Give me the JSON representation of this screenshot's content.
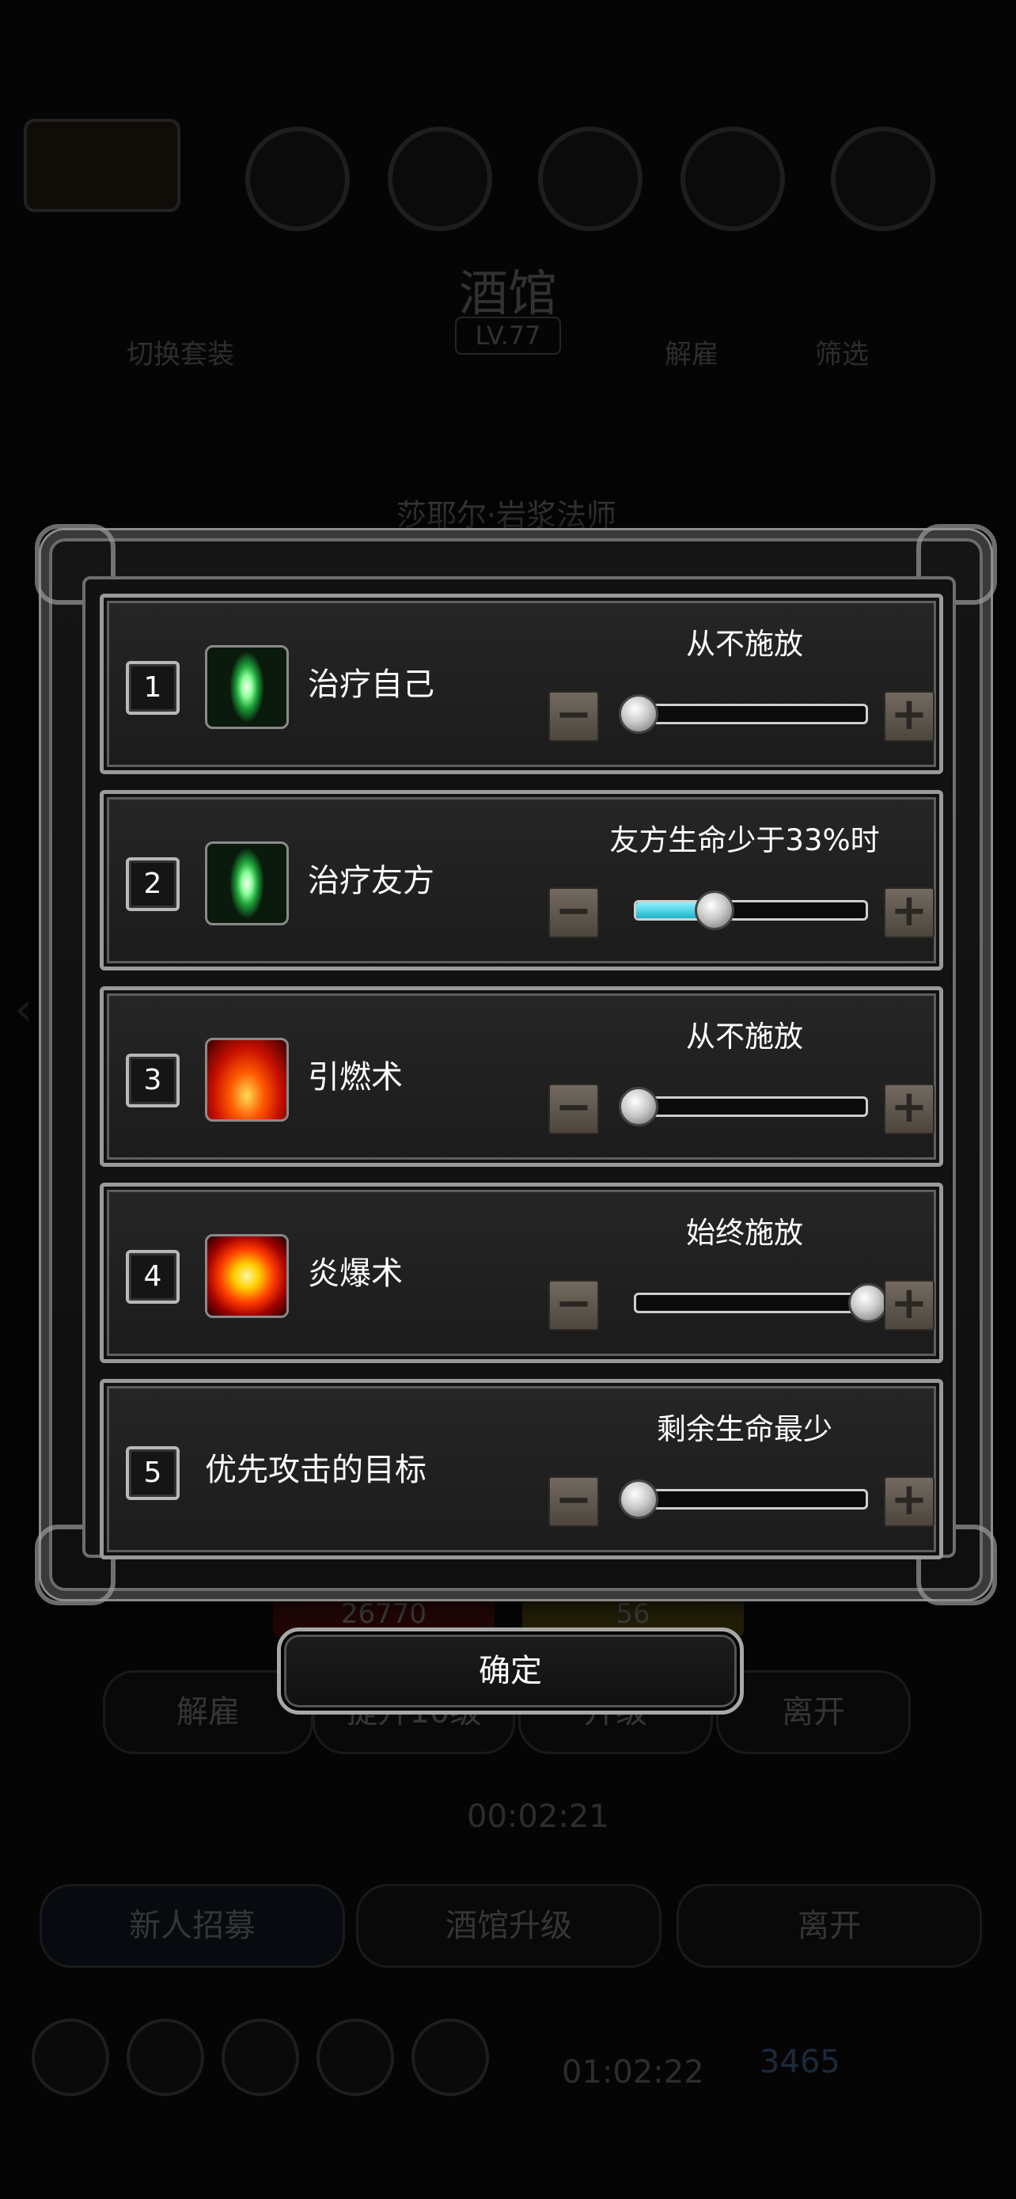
{
  "background": {
    "title": "酒馆",
    "level": "LV.77",
    "tab_left": "切换套装",
    "tab_fire": "解雇",
    "tab_filter": "筛选",
    "hero_name": "莎耶尔·岩浆法师",
    "hp_value": "26770",
    "energy_value": "56",
    "btn_fire": "解雇",
    "btn_upgrade10": "提升10级",
    "btn_upgrade": "升级",
    "btn_leave": "离开",
    "timer_top": "00:02:21",
    "btn_recruit": "新人招募",
    "btn_tavern_upgrade": "酒馆升级",
    "btn_leave2": "离开",
    "timer_bottom": "01:02:22",
    "gems": "3465"
  },
  "dialog": {
    "rows": [
      {
        "index": "1",
        "name": "治疗自己",
        "icon": "heal-crystal-icon",
        "condition": "从不施放",
        "slider_value": 0.0
      },
      {
        "index": "2",
        "name": "治疗友方",
        "icon": "heal-crystal-icon",
        "condition": "友方生命少于33%时",
        "slider_value": 0.33
      },
      {
        "index": "3",
        "name": "引燃术",
        "icon": "ignite-fire-icon",
        "condition": "从不施放",
        "slider_value": 0.0
      },
      {
        "index": "4",
        "name": "炎爆术",
        "icon": "pyroblast-icon",
        "condition": "始终施放",
        "slider_value": 1.0
      },
      {
        "index": "5",
        "name": "优先攻击的目标",
        "icon": "",
        "condition": "剩余生命最少",
        "slider_value": 0.0
      }
    ],
    "minus_symbol": "−",
    "plus_symbol": "+",
    "confirm_label": "确定"
  },
  "colors": {
    "slider_fill": "#1fb3cc",
    "frame": "#9a9a9a"
  }
}
